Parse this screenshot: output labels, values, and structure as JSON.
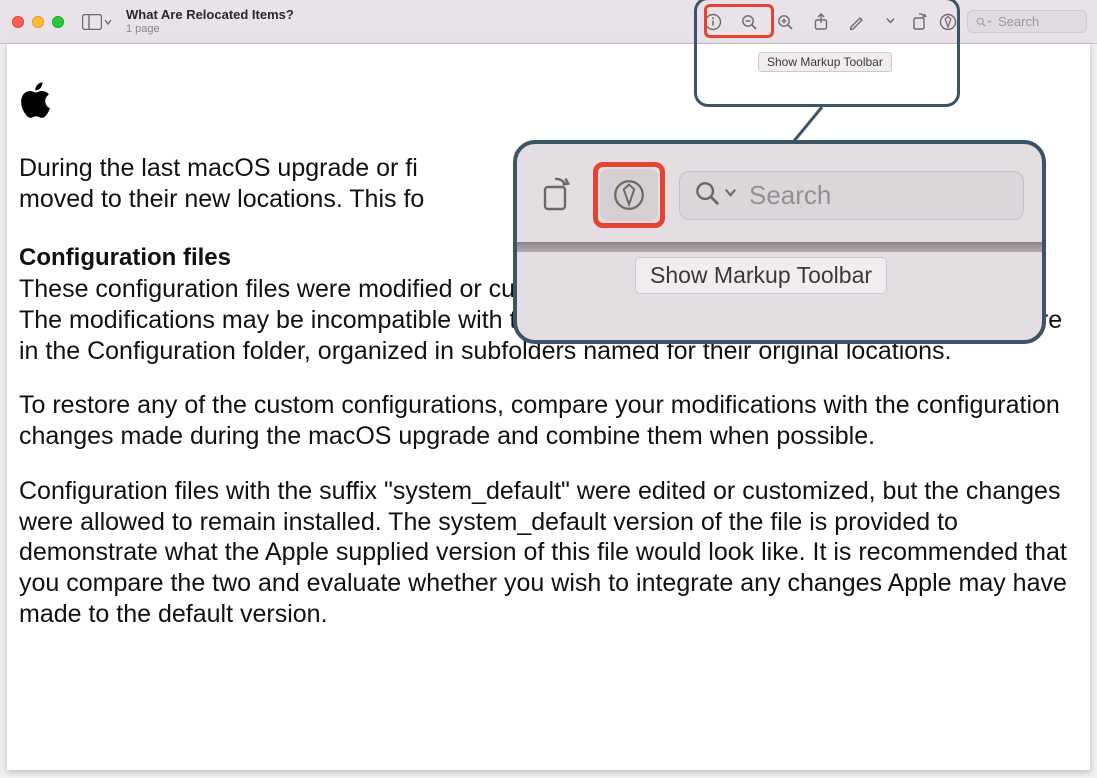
{
  "window": {
    "title": "What Are Relocated Items?",
    "subtitle": "1 page"
  },
  "toolbar": {
    "search_placeholder": "Search",
    "tooltip": "Show Markup Toolbar"
  },
  "zoom": {
    "search_placeholder": "Search",
    "tooltip": "Show Markup Toolbar"
  },
  "document": {
    "intro_partial_1": "During the last macOS upgrade or fi",
    "intro_partial_2": "be moved to their new locations. This fo",
    "section_heading": "Configuration files",
    "p1_partial": "These configuration files were modified or cu",
    "p1_rest": "The modifications may be incompatible with the recent macOS upgrade. The modified files are in the Configuration folder, organized in subfolders named for their original locations.",
    "p2": "To restore any of the custom configurations, compare your modifications with the configuration changes made during the macOS upgrade and combine them when possible.",
    "p3": "Configuration files with the suffix \"system_default\" were edited or customized, but the changes were allowed to remain installed. The system_default version of the file is provided to demonstrate what the Apple supplied version of this file would look like. It is recommended that you compare the two and evaluate whether you wish to integrate any changes Apple may have made to the default version."
  }
}
